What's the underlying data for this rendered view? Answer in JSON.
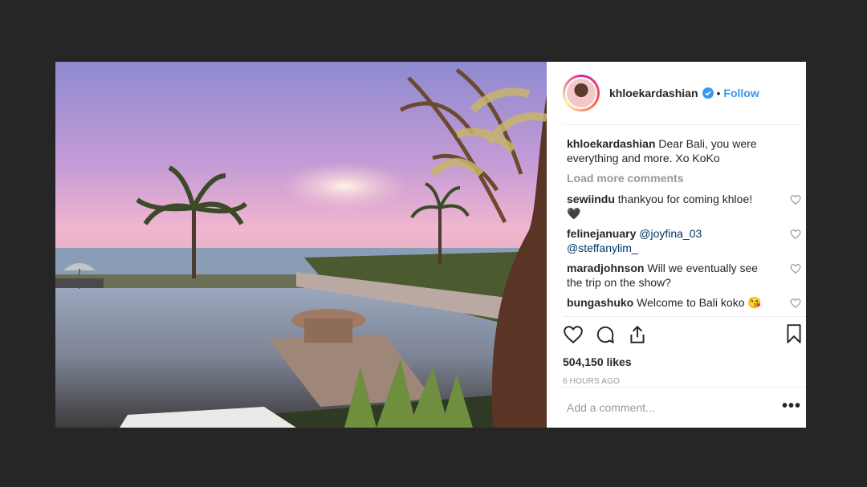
{
  "post": {
    "username": "khloekardashian",
    "follow_label": "Follow",
    "dot": "•",
    "caption_user": "khloekardashian",
    "caption_text": "Dear Bali, you were everything and more. Xo KoKo",
    "load_more": "Load more comments",
    "comments": [
      {
        "user": "sewiindu",
        "text": "thankyou for coming khloe!",
        "extra": "🖤"
      },
      {
        "user": "felinejanuary",
        "mention1": "@joyfina_03",
        "mention2": "@steffanylim_"
      },
      {
        "user": "maradjohnson",
        "text": "Will we eventually see the trip on the show?"
      },
      {
        "user": "bungashuko",
        "text": "Welcome to Bali koko",
        "emoji": "😘"
      }
    ],
    "likes": "504,150 likes",
    "time": "6 HOURS AGO",
    "add_comment_placeholder": "Add a comment...",
    "more": "•••"
  },
  "colors": {
    "accent": "#3897f0",
    "verified": "#3897f0",
    "background": "#262626"
  },
  "icons": [
    "heart-icon",
    "comment-icon",
    "share-icon",
    "bookmark-icon",
    "verified-badge-icon",
    "more-options-icon"
  ]
}
